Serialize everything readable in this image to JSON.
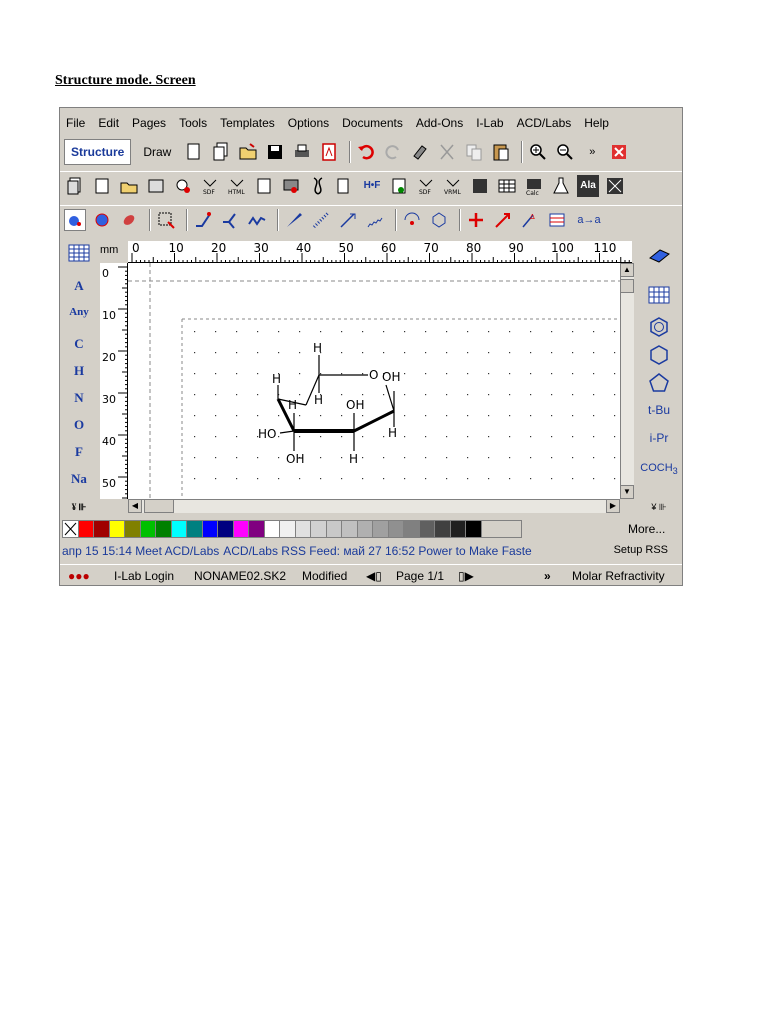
{
  "doc_title": "Structure mode. Screen",
  "menu": [
    "File",
    "Edit",
    "Pages",
    "Tools",
    "Templates",
    "Options",
    "Documents",
    "Add-Ons",
    "I-Lab",
    "ACD/Labs",
    "Help"
  ],
  "toolbar": {
    "mode_structure": "Structure",
    "mode_draw": "Draw",
    "overflow": "»"
  },
  "ruler": {
    "unit": "mm",
    "h_ticks": [
      "0",
      "10",
      "20",
      "30",
      "40",
      "50",
      "60",
      "70",
      "80",
      "90",
      "100",
      "110",
      "1:"
    ],
    "v_ticks": [
      "0",
      "10",
      "20",
      "30",
      "40",
      "50"
    ]
  },
  "left_palette": [
    "A",
    "Any",
    "C",
    "H",
    "N",
    "O",
    "F",
    "Na"
  ],
  "right_palette": {
    "tbu": "t-Bu",
    "ipr": "i-Pr",
    "coch3": "COCH3"
  },
  "molecule": {
    "atoms": [
      "H",
      "O",
      "OH",
      "H",
      "H",
      "H",
      "OH",
      "HO",
      "H",
      "OH",
      "H"
    ]
  },
  "colors": [
    "#ff0000",
    "#a00000",
    "#ffff00",
    "#808000",
    "#00c000",
    "#008000",
    "#00ffff",
    "#008080",
    "#0000ff",
    "#000080",
    "#ff00ff",
    "#800080",
    "#ffffff",
    "#f0f0f0",
    "#e0e0e0",
    "#d0d0d0",
    "#c8c8c8",
    "#c0c0c0",
    "#b0b0b0",
    "#a0a0a0",
    "#909090",
    "#808080",
    "#606060",
    "#404040",
    "#202020",
    "#000000"
  ],
  "more_label": "More...",
  "rss": {
    "item1": "апр 15 15:14 Meet ACD/Labs",
    "item2": "ACD/Labs RSS Feed: май 27 16:52 Power to Make Faste",
    "setup": "Setup RSS"
  },
  "status": {
    "login": "I-Lab Login",
    "file": "NONAME02.SK2",
    "state": "Modified",
    "page": "Page 1/1",
    "more": "»",
    "property": "Molar Refractivity"
  }
}
